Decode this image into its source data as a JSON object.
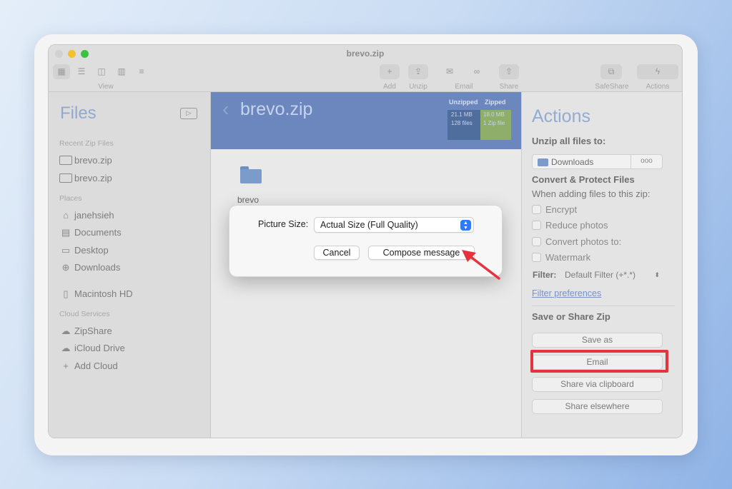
{
  "window": {
    "title": "brevo.zip",
    "traffic_colors": [
      "#d1d1d1",
      "#f5bf2f",
      "#3cc23f"
    ]
  },
  "toolbar": {
    "view_label": "View",
    "add_label": "Add",
    "unzip_label": "Unzip",
    "email_label": "Email",
    "share_label": "Share",
    "safeshare_label": "SafeShare",
    "actions_label": "Actions"
  },
  "sidebar": {
    "title": "Files",
    "recent_heading": "Recent Zip Files",
    "recent": [
      "brevo.zip",
      "brevo.zip"
    ],
    "places_heading": "Places",
    "places": [
      "janehsieh",
      "Documents",
      "Desktop",
      "Downloads"
    ],
    "disk": "Macintosh HD",
    "cloud_heading": "Cloud Services",
    "cloud": [
      "ZipShare",
      "iCloud Drive",
      "Add Cloud"
    ]
  },
  "main": {
    "title": "brevo.zip",
    "unzipped_heading": "Unzipped",
    "zipped_heading": "Zipped",
    "unzipped_size": "21.1 MB",
    "unzipped_count": "128 files",
    "zipped_size": "18.0 MB",
    "zipped_count": "1 Zip file",
    "folder_name": "brevo"
  },
  "actions": {
    "title": "Actions",
    "unzip_all": "Unzip all files to:",
    "destination": "Downloads",
    "destination_more": "ooo",
    "convert_heading": "Convert & Protect Files",
    "convert_sub": "When adding files to this zip:",
    "options": [
      "Encrypt",
      "Reduce photos",
      "Convert photos to:",
      "Watermark"
    ],
    "filter_label": "Filter:",
    "filter_value": "Default Filter (+*.*)",
    "filter_link": "Filter preferences",
    "save_heading": "Save or Share Zip",
    "buttons": [
      "Save as",
      "Email",
      "Share via clipboard",
      "Share elsewhere"
    ],
    "highlight_color": "#e6323e"
  },
  "dialog": {
    "picture_size_label": "Picture Size:",
    "picture_size_value": "Actual Size (Full Quality)",
    "cancel_label": "Cancel",
    "compose_label": "Compose message",
    "accent_color": "#2f7bf5"
  }
}
